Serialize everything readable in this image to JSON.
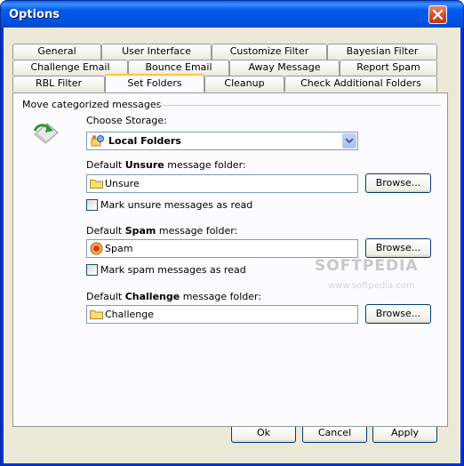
{
  "window": {
    "title": "Options"
  },
  "tabs": {
    "row1": [
      "General",
      "User Interface",
      "Customize Filter",
      "Bayesian Filter"
    ],
    "row2": [
      "Challenge Email",
      "Bounce Email",
      "Away Message",
      "Report Spam"
    ],
    "row3": [
      "RBL Filter",
      "Set Folders",
      "Cleanup",
      "Check Additional Folders"
    ],
    "active": "Set Folders"
  },
  "panel": {
    "group_title": "Move categorized messages",
    "storage_label": "Choose Storage:",
    "storage_value": "Local Folders",
    "unsure": {
      "label_prefix": "Default ",
      "label_bold": "Unsure",
      "label_suffix": " message folder:",
      "value": "Unsure",
      "browse": "Browse...",
      "checkbox": "Mark unsure messages as read"
    },
    "spam": {
      "label_prefix": "Default ",
      "label_bold": "Spam",
      "label_suffix": " message folder:",
      "value": "Spam",
      "browse": "Browse...",
      "checkbox": "Mark spam messages as read"
    },
    "challenge": {
      "label_prefix": "Default ",
      "label_bold": "Challenge",
      "label_suffix": " message folder:",
      "value": "Challenge",
      "browse": "Browse..."
    }
  },
  "watermark": {
    "main": "SOFTPEDIA",
    "sub": "www.softpedia.com"
  },
  "footer": {
    "ok": "Ok",
    "cancel": "Cancel",
    "apply": "Apply"
  },
  "icons": {
    "close": "close-icon",
    "storage": "move-arrow-icon",
    "combo_item": "storage-tree-icon",
    "folder": "folder-icon",
    "spam": "spam-icon",
    "dropdown": "chevron-down-icon"
  },
  "colors": {
    "title_bar": "#0054e3",
    "dialog_bg": "#ece9d8",
    "panel_bg": "#fcfcfe",
    "tab_highlight": "#ffc83c",
    "button_border": "#003c74"
  }
}
